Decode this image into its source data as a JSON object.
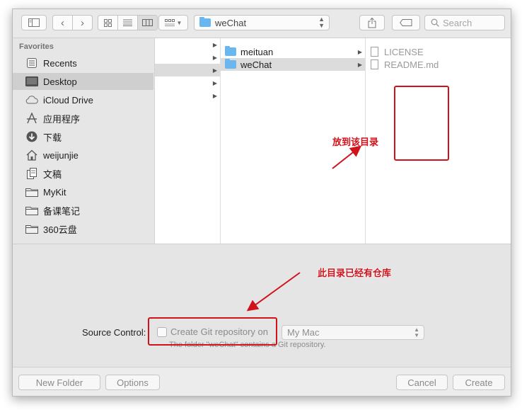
{
  "toolbar": {
    "path_label": "weChat",
    "search_placeholder": "Search"
  },
  "sidebar": {
    "section_title": "Favorites",
    "items": [
      {
        "label": "Recents",
        "icon": "clock-icon"
      },
      {
        "label": "Desktop",
        "icon": "desktop-icon",
        "selected": true
      },
      {
        "label": "iCloud Drive",
        "icon": "cloud-icon"
      },
      {
        "label": "应用程序",
        "icon": "applications-icon"
      },
      {
        "label": "下载",
        "icon": "download-icon"
      },
      {
        "label": "weijunjie",
        "icon": "home-icon"
      },
      {
        "label": "文稿",
        "icon": "documents-icon"
      },
      {
        "label": "MyKit",
        "icon": "folder-icon"
      },
      {
        "label": "备课笔记",
        "icon": "folder-icon"
      },
      {
        "label": "360云盘",
        "icon": "folder-icon"
      }
    ]
  },
  "columns": {
    "col2": [
      {
        "label": "meituan",
        "icon": "folder-icon"
      },
      {
        "label": "weChat",
        "icon": "folder-icon",
        "selected": true
      }
    ],
    "col3": [
      {
        "label": "LICENSE",
        "icon": "file-icon"
      },
      {
        "label": "README.md",
        "icon": "file-icon"
      }
    ]
  },
  "source_control": {
    "label": "Source Control:",
    "checkbox_label": "Create Git repository on",
    "checked": false,
    "location_value": "My Mac",
    "note": "The folder \"weChat\" contains a Git repository."
  },
  "footer": {
    "new_folder": "New Folder",
    "options": "Options",
    "cancel": "Cancel",
    "create": "Create"
  },
  "annotations": {
    "place_here": "放到该目录",
    "has_repo": "此目录已经有仓库",
    "color": "#d0121b"
  }
}
